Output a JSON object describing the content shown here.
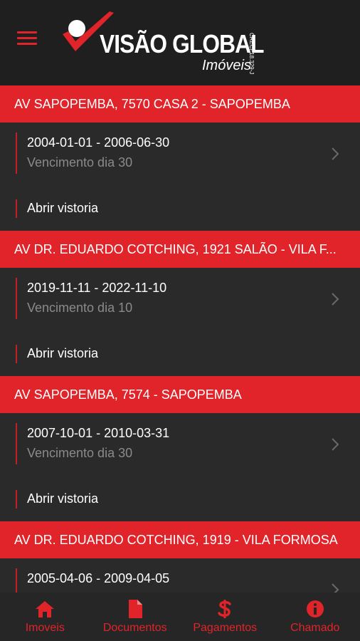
{
  "header": {
    "brand_title": "VISÃO GLOBAL",
    "brand_subtitle": "Imóveis",
    "brand_registration": "CRECI 18.329-J"
  },
  "colors": {
    "accent": "#e0242a",
    "background": "#2a2a2a",
    "header_bg": "#1f1f1f",
    "muted_text": "#8a8a8a"
  },
  "properties": [
    {
      "address": "AV SAPOPEMBA, 7570 CASA 2 - SAPOPEMBA",
      "period": "2004-01-01 - 2006-06-30",
      "due": "Vencimento dia 30",
      "action": "Abrir vistoria"
    },
    {
      "address": "AV DR. EDUARDO COTCHING, 1921 SALÃO - VILA F...",
      "period": "2019-11-11 - 2022-11-10",
      "due": "Vencimento dia 10",
      "action": "Abrir vistoria"
    },
    {
      "address": "AV SAPOPEMBA, 7574 - SAPOPEMBA",
      "period": "2007-10-01 - 2010-03-31",
      "due": "Vencimento dia 30",
      "action": "Abrir vistoria"
    },
    {
      "address": "AV DR. EDUARDO COTCHING, 1919 - VILA FORMOSA",
      "period": "2005-04-06 - 2009-04-05",
      "due": "",
      "action": ""
    }
  ],
  "tabs": [
    {
      "label": "Imoveis",
      "icon": "home-icon"
    },
    {
      "label": "Documentos",
      "icon": "document-icon"
    },
    {
      "label": "Pagamentos",
      "icon": "dollar-icon"
    },
    {
      "label": "Chamado",
      "icon": "info-icon"
    }
  ]
}
